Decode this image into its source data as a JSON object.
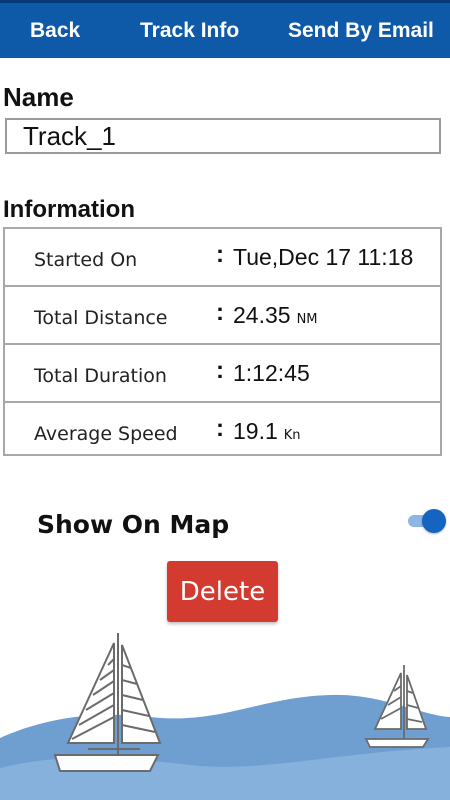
{
  "topbar": {
    "back_label": "Back",
    "title": "Track Info",
    "email_label": "Send By Email",
    "background_color": "#0e5aa8"
  },
  "name_section": {
    "heading": "Name",
    "value": "Track_1"
  },
  "information_section": {
    "heading": "Information",
    "colon": ":",
    "rows": [
      {
        "label": "Started On",
        "value": "Tue,Dec 17 11:18",
        "unit": ""
      },
      {
        "label": "Total Distance",
        "value": "24.35",
        "unit": "NM"
      },
      {
        "label": "Total Duration",
        "value": "1:12:45",
        "unit": ""
      },
      {
        "label": "Average Speed",
        "value": "19.1",
        "unit": "Kn"
      }
    ]
  },
  "show_on_map": {
    "label": "Show On Map",
    "enabled": true,
    "accent_color": "#1565c0"
  },
  "delete_button": {
    "label": "Delete",
    "color": "#d33a30"
  },
  "decoration": {
    "icons": [
      "sailboat-large-icon",
      "sailboat-small-icon",
      "wave-icon"
    ],
    "wave_color": "#6f9fd0"
  }
}
